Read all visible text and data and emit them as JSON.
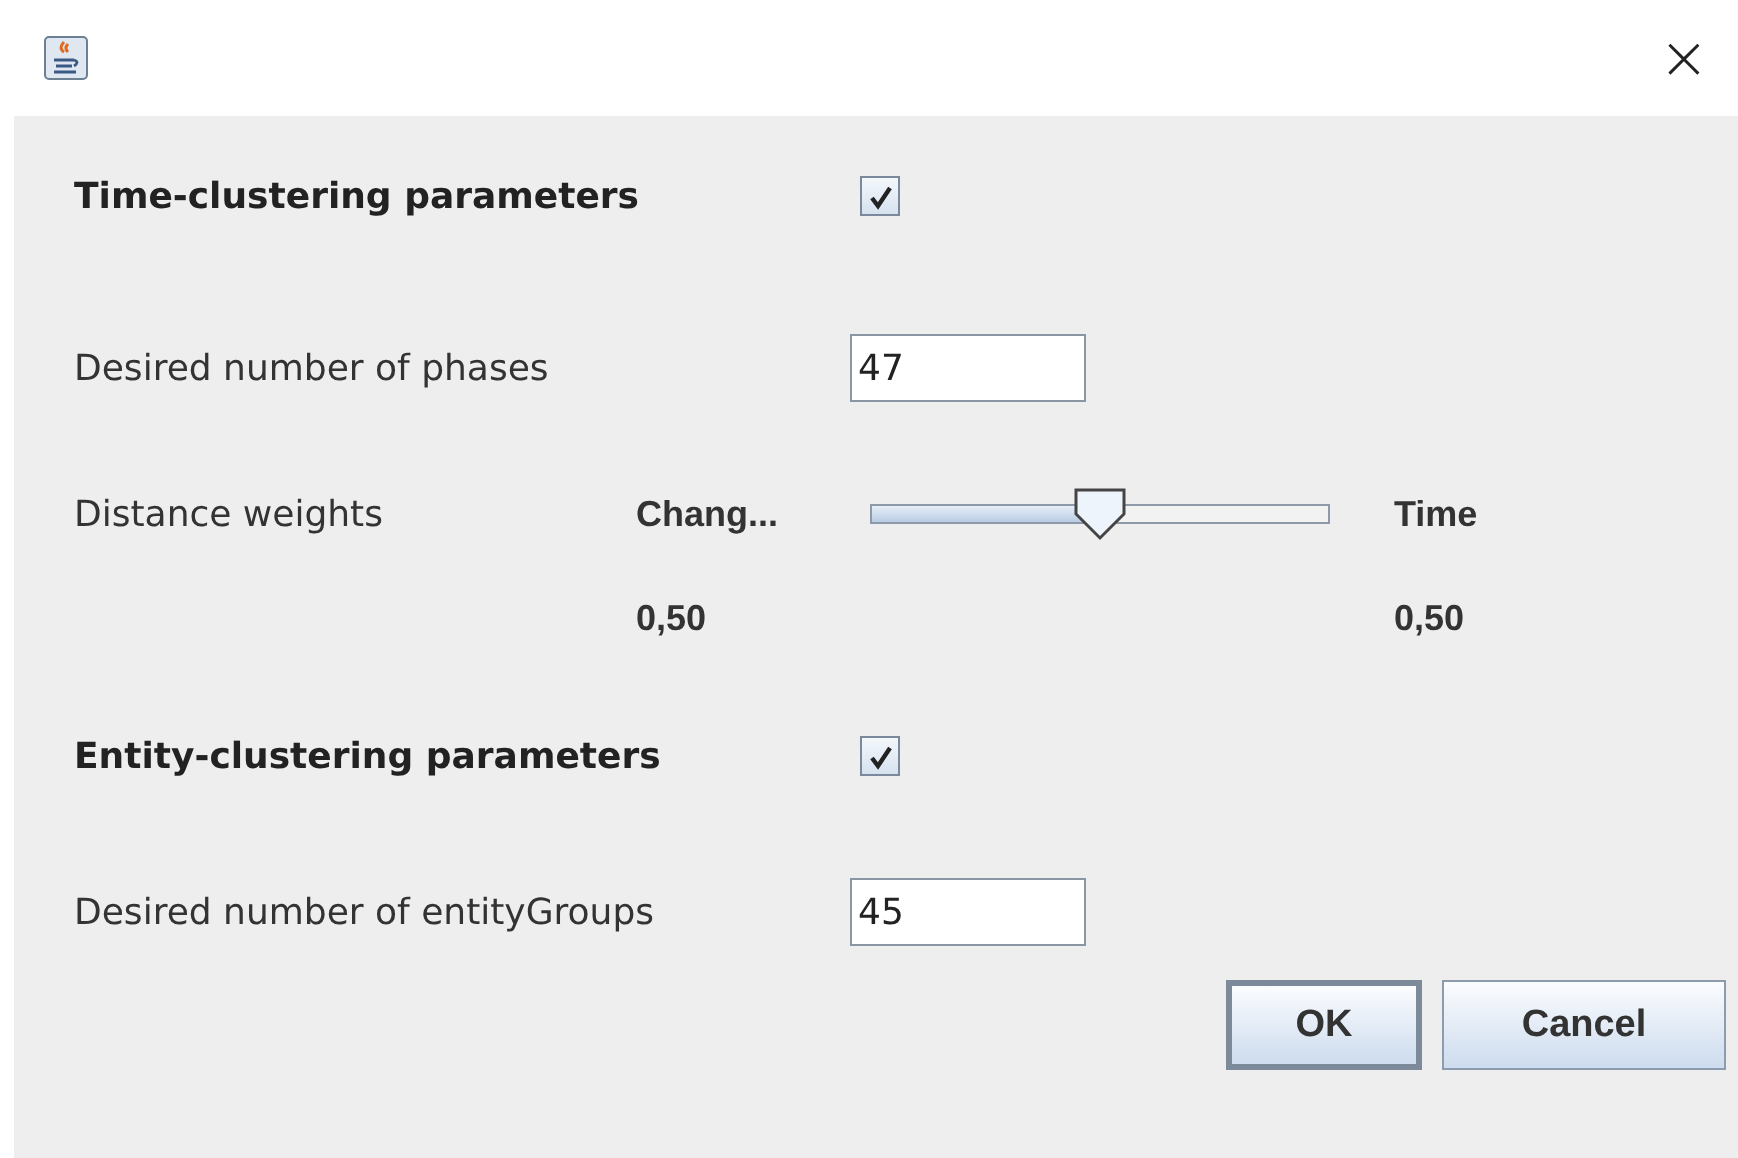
{
  "window": {
    "close": "×"
  },
  "time_clustering": {
    "title": "Time-clustering parameters",
    "checked": true,
    "phases": {
      "label": "Desired number of phases",
      "value": "47"
    },
    "distance_weights": {
      "label": "Distance weights",
      "left_label": "Chang...",
      "right_label": "Time",
      "level": 0.5,
      "left_value": "0,50",
      "right_value": "0,50"
    }
  },
  "entity_clustering": {
    "title": "Entity-clustering parameters",
    "checked": true,
    "groups": {
      "label": "Desired number of entityGroups",
      "value": "45"
    }
  },
  "buttons": [
    {
      "label": "OK",
      "default": true
    },
    {
      "label": "Cancel",
      "default": false
    }
  ]
}
